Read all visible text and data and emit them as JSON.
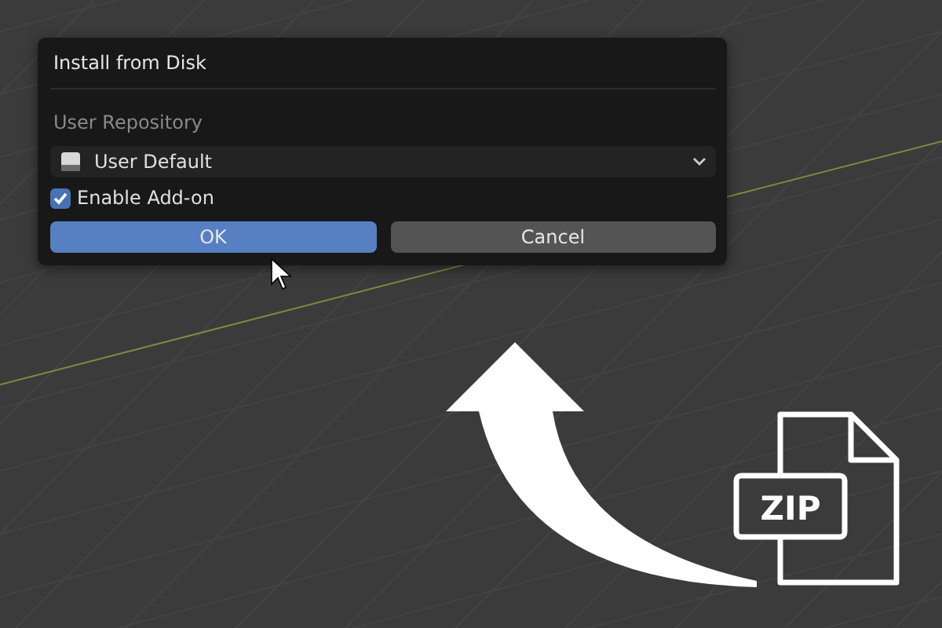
{
  "dialog": {
    "title": "Install from Disk",
    "section_label": "User Repository",
    "repository_dropdown": {
      "value": "User Default"
    },
    "enable_addon": {
      "label": "Enable Add-on",
      "checked": true
    },
    "buttons": [
      {
        "label": "OK",
        "kind": "primary"
      },
      {
        "label": "Cancel",
        "kind": "secondary"
      }
    ]
  },
  "overlay": {
    "file_label": "ZIP"
  }
}
